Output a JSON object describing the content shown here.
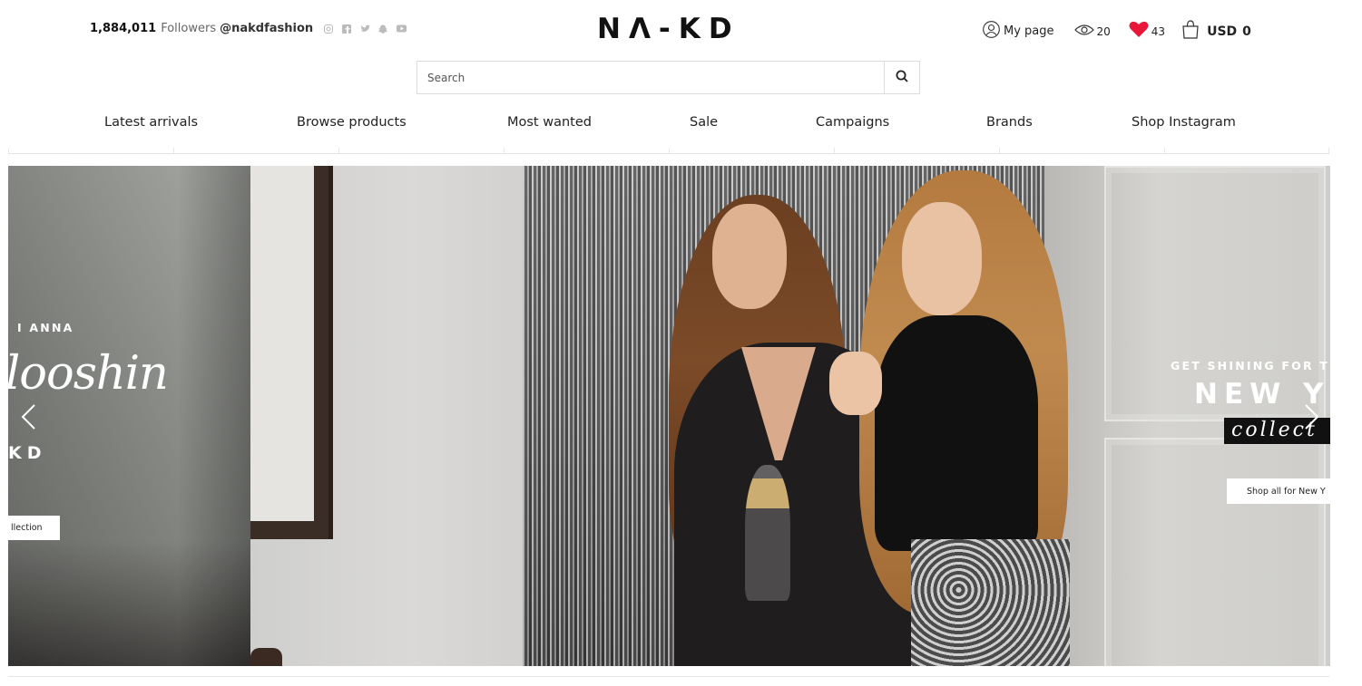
{
  "social": {
    "followers_count": "1,884,011",
    "followers_label": "Followers",
    "handle": "@nakdfashion",
    "icons": [
      "instagram-icon",
      "facebook-icon",
      "twitter-icon",
      "snapchat-icon",
      "youtube-icon"
    ]
  },
  "header": {
    "logo": "NΛ-KD",
    "my_page": "My page",
    "views_count": "20",
    "likes_count": "43",
    "currency": "USD",
    "cart_total": "0"
  },
  "search": {
    "placeholder": "Search"
  },
  "nav": {
    "items": [
      {
        "label": "Latest arrivals"
      },
      {
        "label": "Browse products"
      },
      {
        "label": "Most wanted"
      },
      {
        "label": "Sale"
      },
      {
        "label": "Campaigns"
      },
      {
        "label": "Brands"
      },
      {
        "label": "Shop Instagram"
      }
    ]
  },
  "hero": {
    "left_slide": {
      "kicker": "I ANNA",
      "script": "looshin",
      "brand": "KD",
      "button": "llection"
    },
    "right_slide": {
      "kicker": "GET SHINING FOR TH",
      "headline": "NEW YE",
      "script": "collect",
      "button": "Shop all for New Y"
    }
  },
  "colors": {
    "heart": "#e8173a",
    "text": "#222222",
    "border": "#dcdcdc"
  }
}
